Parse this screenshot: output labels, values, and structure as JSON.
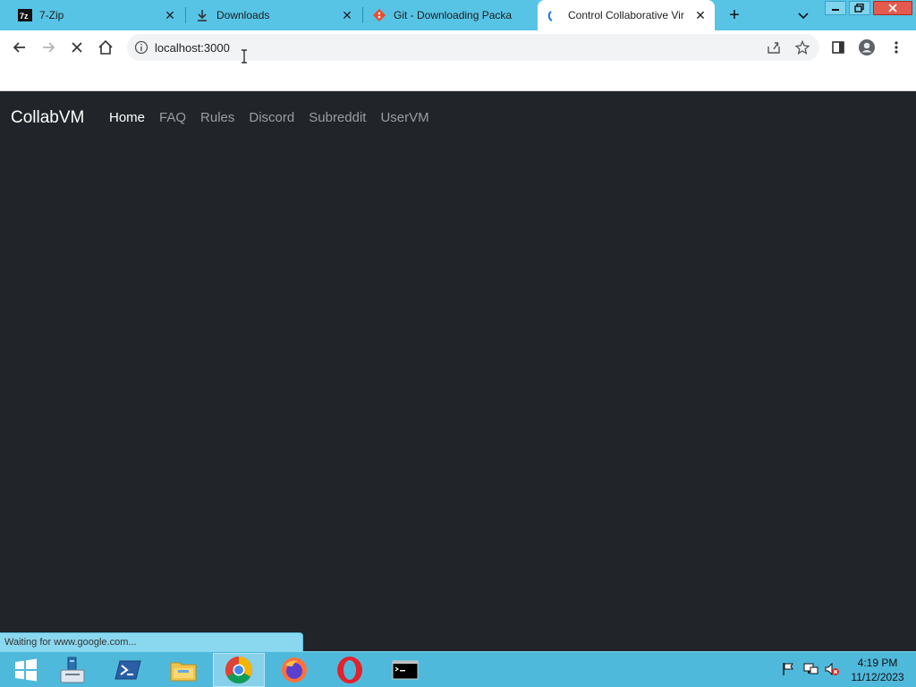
{
  "browser": {
    "tabs": [
      {
        "title": "7-Zip",
        "favicon": "7zip-icon",
        "active": false
      },
      {
        "title": "Downloads",
        "favicon": "download-icon",
        "active": false
      },
      {
        "title": "Git - Downloading Packa",
        "favicon": "git-icon",
        "active": false
      },
      {
        "title": "Control Collaborative Vir",
        "favicon": "loading-spinner-icon",
        "active": true
      }
    ],
    "new_tab_label": "+",
    "address": {
      "url": "localhost:3000"
    },
    "status_text": "Waiting for www.google.com..."
  },
  "page": {
    "brand": "CollabVM",
    "nav": [
      {
        "label": "Home",
        "active": true
      },
      {
        "label": "FAQ",
        "active": false
      },
      {
        "label": "Rules",
        "active": false
      },
      {
        "label": "Discord",
        "active": false
      },
      {
        "label": "Subreddit",
        "active": false
      },
      {
        "label": "UserVM",
        "active": false
      }
    ]
  },
  "taskbar": {
    "apps": [
      "windows-start-icon",
      "server-manager-icon",
      "powershell-icon",
      "file-explorer-icon",
      "chrome-icon",
      "firefox-icon",
      "opera-icon",
      "command-prompt-icon"
    ],
    "clock": {
      "time": "4:19 PM",
      "date": "11/12/2023"
    }
  },
  "colors": {
    "accent": "#57c4e6",
    "page_bg": "#212529",
    "taskbar": "#4fb9dc"
  }
}
